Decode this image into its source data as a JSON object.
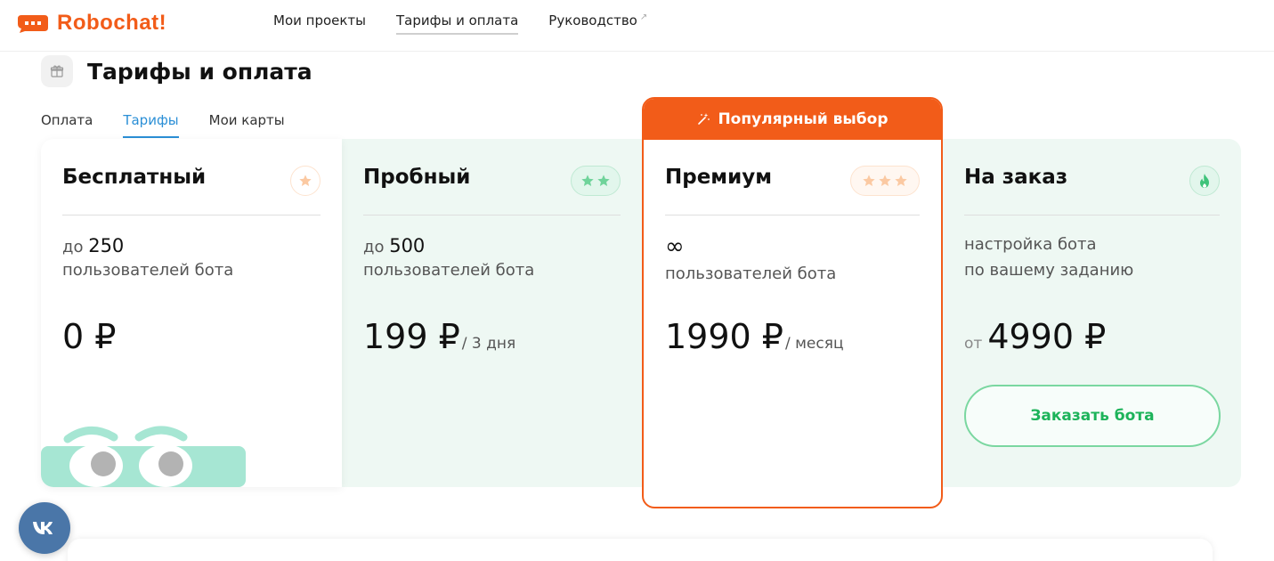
{
  "app": {
    "logo_text": "Robochat!"
  },
  "colors": {
    "brand": "#f25c19",
    "accent_blue": "#2b8fd6",
    "green": "#1db35a",
    "mint_bg": "#eef8f3",
    "vk": "#4a76a8"
  },
  "nav": {
    "items": [
      {
        "label": "Мои проекты"
      },
      {
        "label": "Тарифы и оплата"
      },
      {
        "label": "Руководство"
      }
    ],
    "external_arrow": "↗"
  },
  "page": {
    "title": "Тарифы и оплата",
    "icon": "gift-icon"
  },
  "tabs": [
    {
      "label": "Оплата"
    },
    {
      "label": "Тарифы"
    },
    {
      "label": "Мои карты"
    }
  ],
  "popular_banner": {
    "label": "Популярный выбор",
    "icon": "magic-wand-icon"
  },
  "plans": [
    {
      "name": "Бесплатный",
      "stars": 1,
      "users_prefix": "до",
      "users_value": "250",
      "users_text": "пользователей бота",
      "price": "0 ₽",
      "price_suffix": ""
    },
    {
      "name": "Пробный",
      "stars": 2,
      "users_prefix": "до",
      "users_value": "500",
      "users_text": "пользователей бота",
      "price": "199 ₽",
      "price_suffix": "/ 3 дня"
    },
    {
      "name": "Премиум",
      "stars": 3,
      "users_value": "∞",
      "users_text": "пользователей бота",
      "price": "1990 ₽",
      "price_suffix": "/ месяц"
    },
    {
      "name": "На заказ",
      "icon": "flame-icon",
      "desc_line1": "настройка бота",
      "desc_line2": "по вашему заданию",
      "price_prefix": "от",
      "price": "4990 ₽",
      "button_label": "Заказать бота"
    }
  ],
  "vk": {
    "label": "vk"
  }
}
